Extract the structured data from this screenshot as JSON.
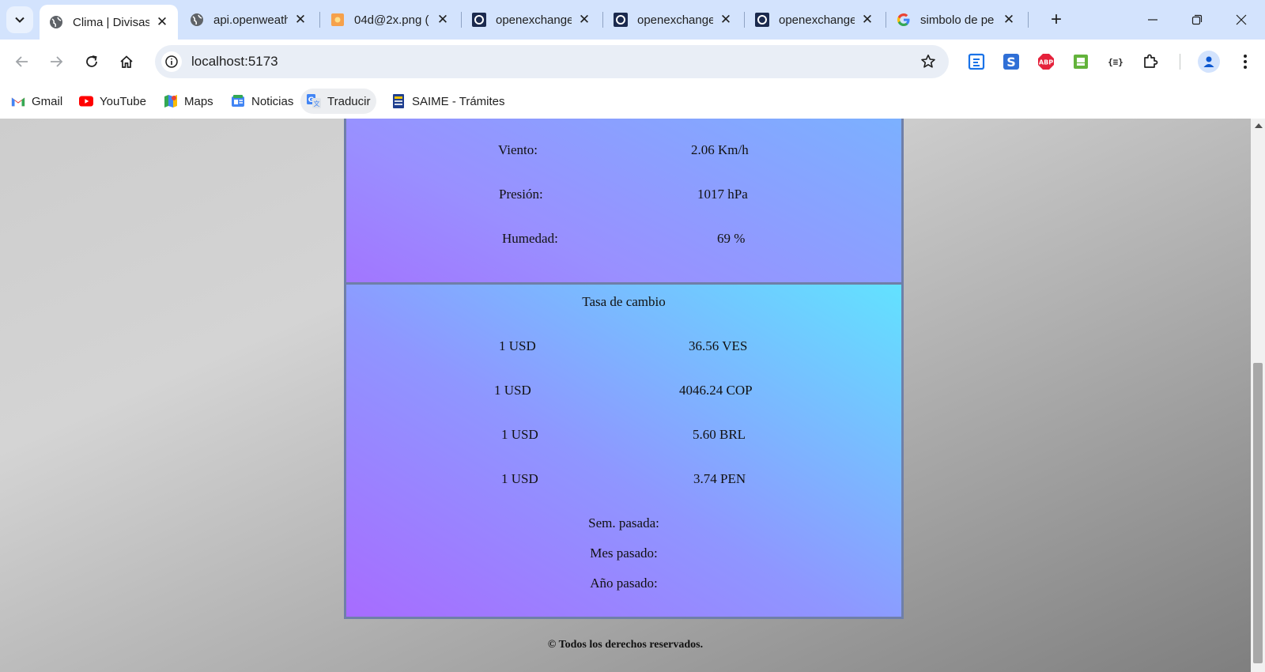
{
  "browser": {
    "tabs": [
      {
        "title": "Clima | Divisas",
        "favicon": "globe-icon",
        "active": true
      },
      {
        "title": "api.openweath",
        "favicon": "globe-icon",
        "active": false
      },
      {
        "title": "04d@2x.png (",
        "favicon": "image-icon",
        "active": false
      },
      {
        "title": "openexchange",
        "favicon": "openexchange-icon",
        "active": false
      },
      {
        "title": "openexchange",
        "favicon": "openexchange-icon",
        "active": false
      },
      {
        "title": "openexchange",
        "favicon": "openexchange-icon",
        "active": false
      },
      {
        "title": "simbolo de pe",
        "favicon": "google-icon",
        "active": false
      }
    ],
    "new_tab": "+",
    "url": "localhost:5173",
    "bookmarks": [
      {
        "label": "Gmail",
        "icon": "gmail-icon"
      },
      {
        "label": "YouTube",
        "icon": "youtube-icon"
      },
      {
        "label": "Maps",
        "icon": "maps-icon"
      },
      {
        "label": "Noticias",
        "icon": "news-icon"
      },
      {
        "label": "Traducir",
        "icon": "translate-icon"
      },
      {
        "label": "SAIME - Trámites",
        "icon": "saime-icon"
      }
    ],
    "extensions": [
      {
        "name": "reader-extension-icon",
        "label": ""
      },
      {
        "name": "s-extension-icon",
        "label": ""
      },
      {
        "name": "adblock-plus-icon",
        "label": "ABP"
      },
      {
        "name": "green-extension-icon",
        "label": ""
      },
      {
        "name": "json-viewer-icon",
        "label": "{≡}"
      },
      {
        "name": "extensions-puzzle-icon",
        "label": ""
      }
    ],
    "colors": {
      "tabstrip": "#d3e3fd",
      "omnibox": "#e9eef6",
      "accent": "#0b57d0"
    }
  },
  "page": {
    "weather": {
      "rows": [
        {
          "label": "Viento:",
          "value": "2.06 Km/h"
        },
        {
          "label": "Presión:",
          "value": "1017 hPa"
        },
        {
          "label": "Humedad:",
          "value": "69 %"
        }
      ]
    },
    "rates": {
      "title": "Tasa de cambio",
      "rows": [
        {
          "base": "1 USD",
          "value": "36.56 VES"
        },
        {
          "base": "1 USD",
          "value": "4046.24 COP"
        },
        {
          "base": "1 USD",
          "value": "5.60 BRL"
        },
        {
          "base": "1 USD",
          "value": "3.74 PEN"
        }
      ],
      "history": [
        "Sem. pasada:",
        "Mes pasado:",
        "Año pasado:"
      ]
    },
    "footer": "© Todos los derechos reservados."
  }
}
